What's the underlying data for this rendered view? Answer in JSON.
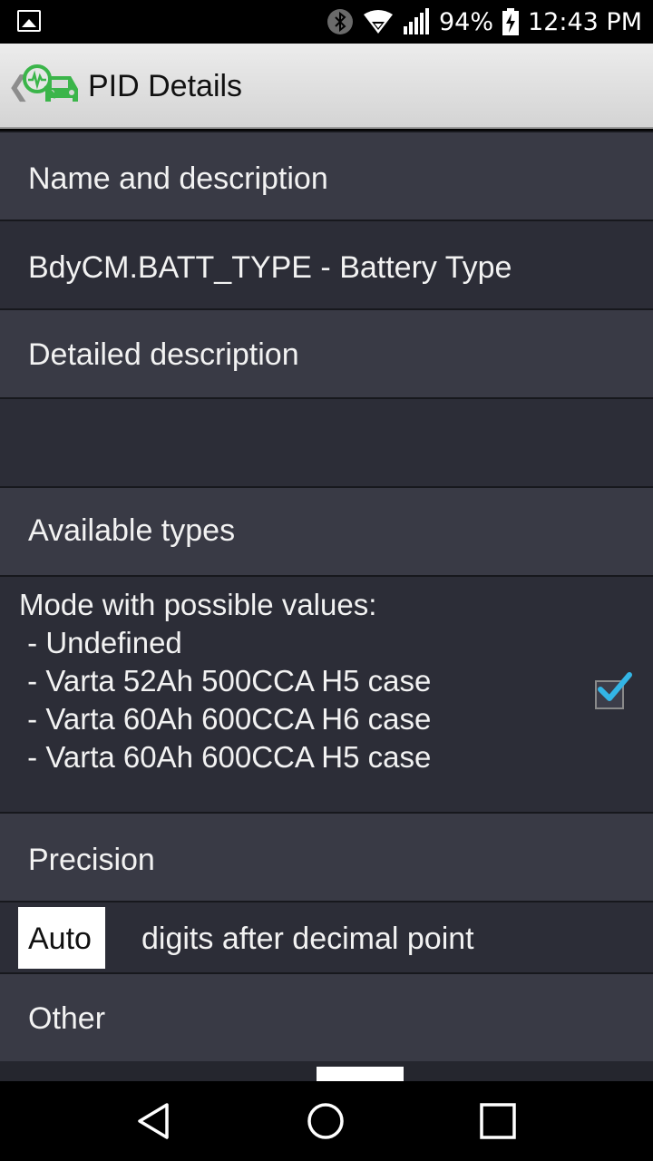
{
  "status_bar": {
    "battery_percent": "94%",
    "time": "12:43 PM",
    "icons": [
      "image-icon",
      "bluetooth-icon",
      "wifi-icon",
      "signal-icon",
      "battery-charging-icon"
    ]
  },
  "action_bar": {
    "title": "PID Details",
    "back_icon": "chevron-left-icon",
    "app_icon": "car-diagnostic-icon"
  },
  "sections": {
    "name_header": "Name and description",
    "name_value": "BdyCM.BATT_TYPE - Battery Type",
    "detailed_header": "Detailed description",
    "detailed_value": "",
    "types_header": "Available types",
    "types_value": "Mode with possible values:\n - Undefined\n - Varta 52Ah 500CCA H5 case\n - Varta 60Ah 600CCA H6 case\n - Varta 60Ah 600CCA H5 case",
    "types_checked": true,
    "precision_header": "Precision",
    "precision_value": "Auto",
    "precision_suffix": "digits after decimal point",
    "other_header": "Other"
  },
  "nav_bar": {
    "icons": [
      "back-icon",
      "home-icon",
      "recents-icon"
    ]
  },
  "colors": {
    "header_row": "#393a45",
    "value_row": "#2c2d37",
    "accent_check": "#33b5e5",
    "app_icon_green": "#3bb54a"
  }
}
